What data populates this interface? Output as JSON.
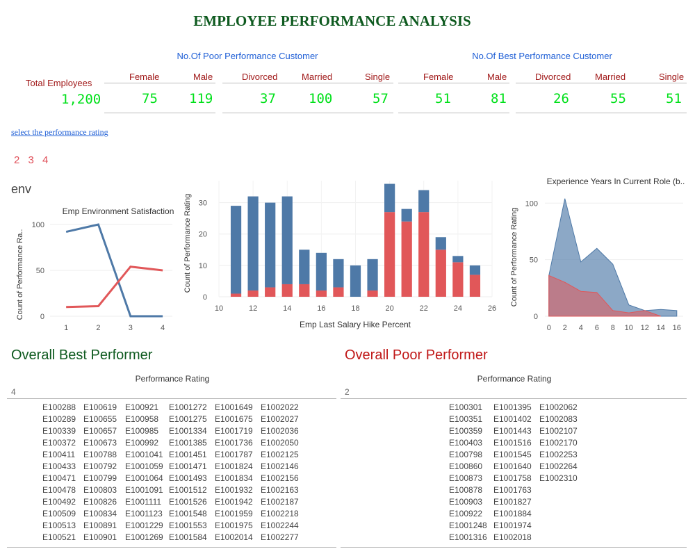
{
  "title": "EMPLOYEE PERFORMANCE ANALYSIS",
  "kpi": {
    "total_label": "Total Employees",
    "total_value": "1,200",
    "poor_header": "No.Of Poor Performance Customer",
    "best_header": "No.Of Best Performance Customer",
    "poor": {
      "female_label": "Female",
      "female": "75",
      "male_label": "Male",
      "male": "119",
      "divorced_label": "Divorced",
      "divorced": "37",
      "married_label": "Married",
      "married": "100",
      "single_label": "Single",
      "single": "57"
    },
    "best": {
      "female_label": "Female",
      "female": "51",
      "male_label": "Male",
      "male": "81",
      "divorced_label": "Divorced",
      "divorced": "26",
      "married_label": "Married",
      "married": "55",
      "single_label": "Single",
      "single": "51"
    }
  },
  "filter": {
    "link": "select the performance rating",
    "ratings": [
      "2",
      "3",
      "4"
    ]
  },
  "env_label": "env",
  "colors": {
    "blue": "#4e79a7",
    "red": "#e15759",
    "green_title": "#0e5a1f",
    "kpi_green": "#00e01a"
  },
  "chart_data": [
    {
      "type": "line",
      "title": "Emp Environment Satisfaction",
      "ylabel": "Count of Performance Ra..",
      "x": [
        1,
        2,
        3,
        4
      ],
      "ylim": [
        0,
        100
      ],
      "yticks": [
        0,
        50,
        100
      ],
      "xticks": [
        1,
        2,
        3,
        4
      ],
      "series": [
        {
          "color": "#4e79a7",
          "values": [
            92,
            100,
            0,
            0
          ]
        },
        {
          "color": "#e15759",
          "values": [
            10,
            11,
            54,
            50
          ]
        }
      ]
    },
    {
      "type": "bar",
      "title": "",
      "xlabel": "Emp Last Salary Hike Percent",
      "ylabel": "Count of Performance Rating",
      "x": [
        11,
        12,
        13,
        14,
        15,
        16,
        17,
        18,
        19,
        20,
        21,
        22,
        23,
        24,
        25
      ],
      "xticks": [
        10,
        12,
        14,
        16,
        18,
        20,
        22,
        24,
        26
      ],
      "yticks": [
        0,
        10,
        20,
        30
      ],
      "ylim": [
        0,
        37
      ],
      "xlim": [
        10,
        26
      ],
      "series": [
        {
          "color": "#e15759",
          "values": [
            1,
            2,
            3,
            4,
            4,
            2,
            3,
            0,
            2,
            27,
            24,
            27,
            15,
            11,
            7
          ]
        },
        {
          "color": "#4e79a7",
          "values": [
            28,
            30,
            27,
            28,
            11,
            12,
            9,
            10,
            10,
            9,
            4,
            7,
            4,
            2,
            3
          ]
        }
      ]
    },
    {
      "type": "area",
      "title": "Experience Years In Current Role (b..",
      "ylabel": "Count of Performance Rating",
      "x": [
        0,
        2,
        4,
        6,
        8,
        10,
        12,
        14,
        16
      ],
      "xticks": [
        0,
        2,
        4,
        6,
        8,
        10,
        12,
        14,
        16
      ],
      "yticks": [
        0,
        50,
        100
      ],
      "ylim": [
        0,
        110
      ],
      "series": [
        {
          "color": "#4e79a7",
          "values": [
            36,
            104,
            48,
            60,
            46,
            10,
            5,
            6,
            5
          ]
        },
        {
          "color": "#e15759",
          "values": [
            36,
            30,
            22,
            21,
            5,
            3,
            5,
            0,
            null
          ]
        }
      ]
    }
  ],
  "best": {
    "heading": "Overall Best Performer",
    "column_header": "Performance Rating",
    "rating": "4",
    "ids": [
      [
        "E100288",
        "E100289",
        "E100339",
        "E100372",
        "E100411",
        "E100433",
        "E100471",
        "E100478",
        "E100492",
        "E100509",
        "E100513",
        "E100521"
      ],
      [
        "E100619",
        "E100655",
        "E100657",
        "E100673",
        "E100788",
        "E100792",
        "E100799",
        "E100803",
        "E100826",
        "E100834",
        "E100891",
        "E100901"
      ],
      [
        "E100921",
        "E100958",
        "E100985",
        "E100992",
        "E1001041",
        "E1001059",
        "E1001064",
        "E1001091",
        "E1001111",
        "E1001123",
        "E1001229",
        "E1001269"
      ],
      [
        "E1001272",
        "E1001275",
        "E1001334",
        "E1001385",
        "E1001451",
        "E1001471",
        "E1001493",
        "E1001512",
        "E1001526",
        "E1001548",
        "E1001553",
        "E1001584"
      ],
      [
        "E1001649",
        "E1001675",
        "E1001719",
        "E1001736",
        "E1001787",
        "E1001824",
        "E1001834",
        "E1001932",
        "E1001942",
        "E1001959",
        "E1001975",
        "E1002014"
      ],
      [
        "E1002022",
        "E1002027",
        "E1002036",
        "E1002050",
        "E1002125",
        "E1002146",
        "E1002156",
        "E1002163",
        "E1002187",
        "E1002218",
        "E1002244",
        "E1002277"
      ]
    ]
  },
  "poor": {
    "heading": "Overall Poor Performer",
    "column_header": "Performance Rating",
    "rating": "2",
    "ids": [
      [
        "E100301",
        "E100351",
        "E100359",
        "E100403",
        "E100798",
        "E100860",
        "E100873",
        "E100878",
        "E100903",
        "E100922",
        "E1001248",
        "E1001316"
      ],
      [
        "E1001395",
        "E1001402",
        "E1001443",
        "E1001516",
        "E1001545",
        "E1001640",
        "E1001758",
        "E1001763",
        "E1001827",
        "E1001884",
        "E1001974",
        "E1002018"
      ],
      [
        "E1002062",
        "E1002083",
        "E1002107",
        "E1002170",
        "E1002253",
        "E1002264",
        "E1002310"
      ]
    ]
  }
}
